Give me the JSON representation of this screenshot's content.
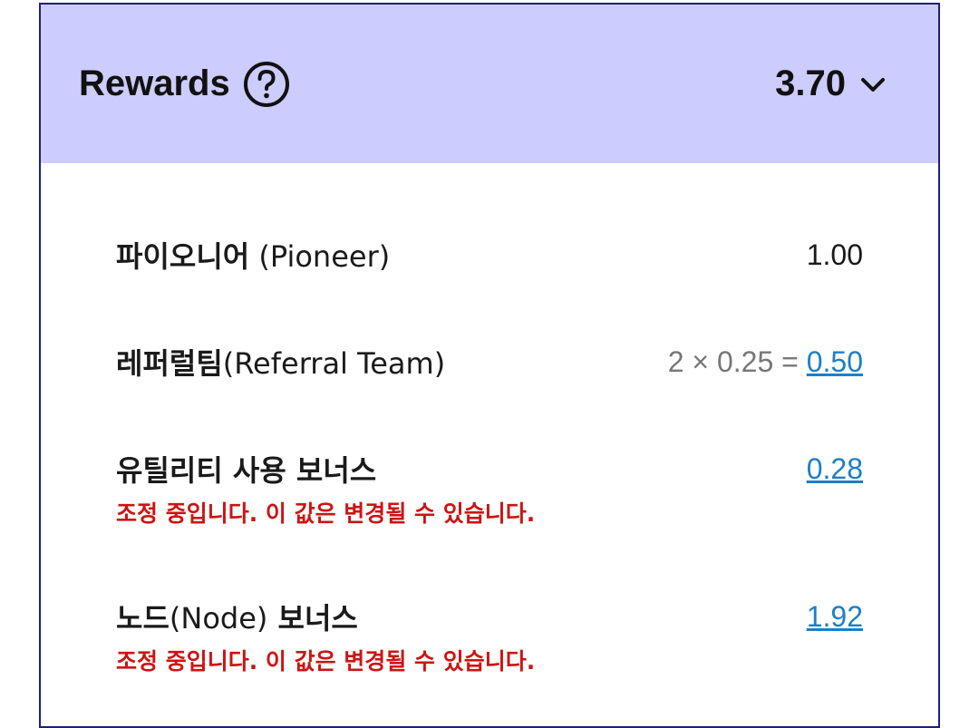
{
  "header": {
    "title": "Rewards",
    "total": "3.70"
  },
  "rows": [
    {
      "label_kr": "파이오니어",
      "label_en": "(Pioneer)",
      "value": "1.00"
    },
    {
      "label_kr": "레퍼럴팀",
      "label_en": "(Referral Team)",
      "calc": "2 × 0.25 = ",
      "value": "0.50"
    },
    {
      "label_kr": "유틸리티 사용 보너스",
      "value": "0.28",
      "notice": "조정 중입니다. 이 값은 변경될 수 있습니다."
    },
    {
      "label_kr": "노드",
      "label_en": "(Node)",
      "label_kr_suffix": " 보너스",
      "value": "1.92",
      "notice": "조정 중입니다. 이 값은 변경될 수 있습니다."
    }
  ],
  "colors": {
    "header_bg": "#ccccff",
    "border": "#1f1f7a",
    "link": "#1e7fc4",
    "warning": "#cc1414"
  },
  "icons": {
    "help": "question-circle-icon",
    "expand": "chevron-down-icon"
  }
}
